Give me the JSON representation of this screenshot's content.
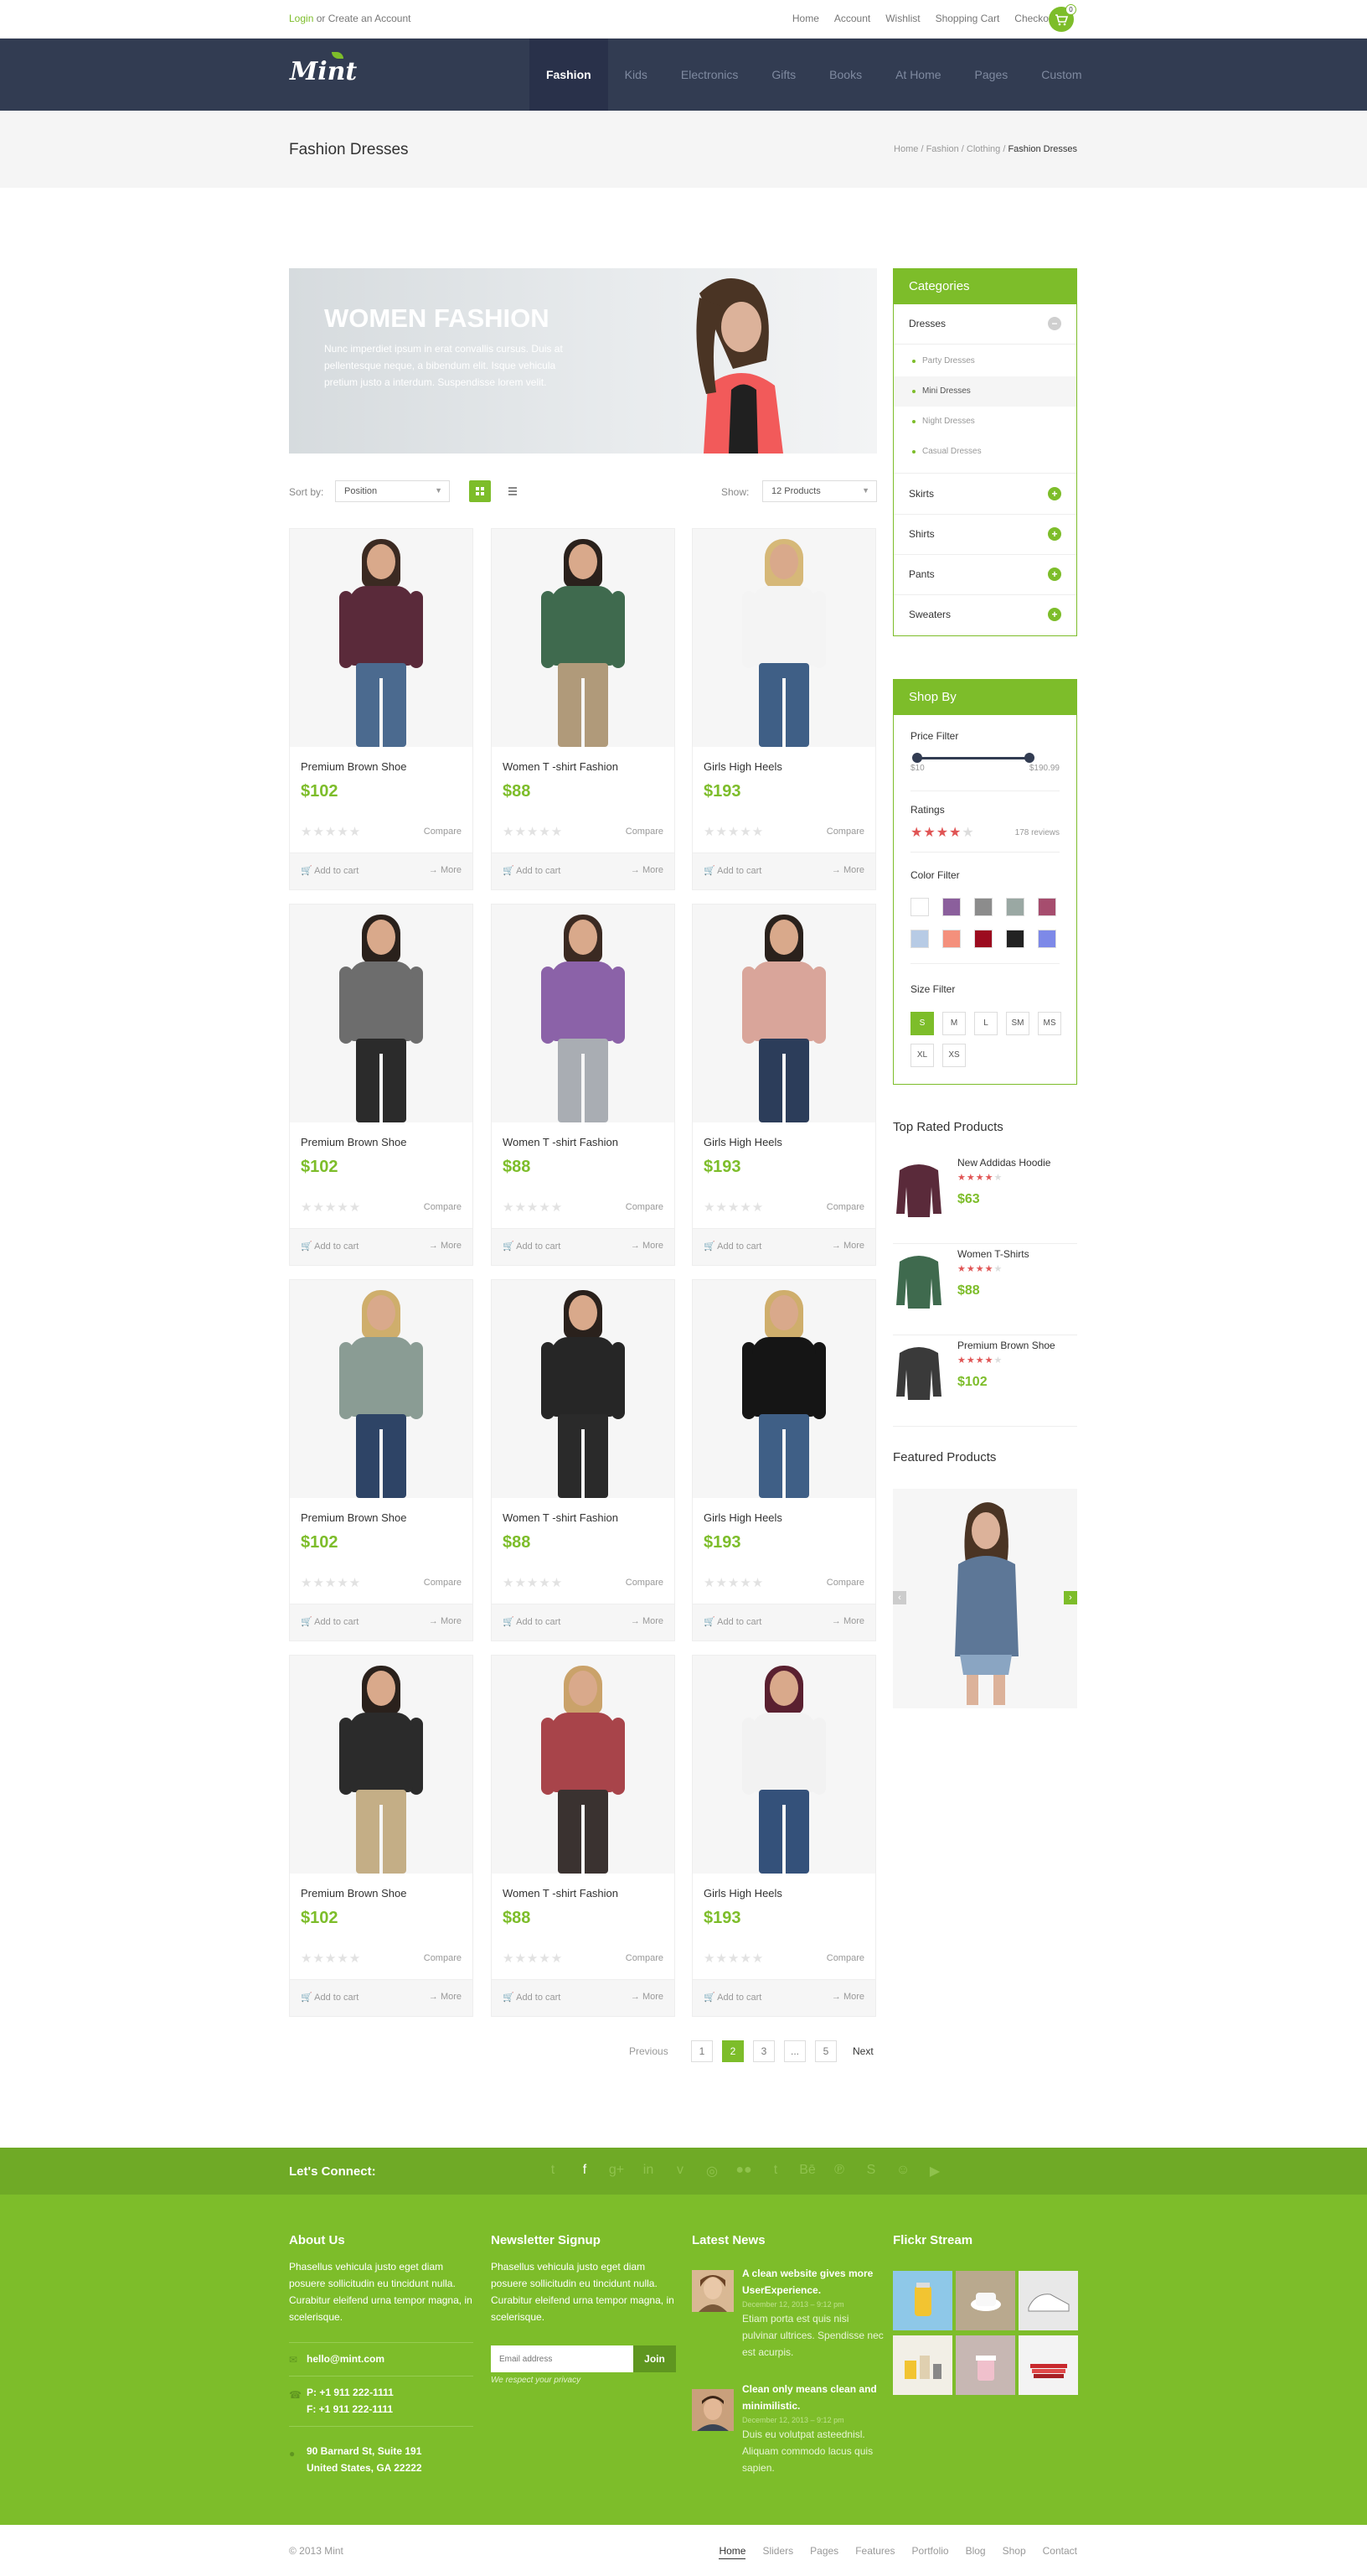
{
  "topbar": {
    "login": "Login",
    "or": "or",
    "create_account": "Create an Account",
    "links": [
      "Home",
      "Account",
      "Wishlist",
      "Shopping Cart",
      "Checkout"
    ],
    "cart_count": "0"
  },
  "brand": {
    "logo": "Mint",
    "accent": "#7dbd2a",
    "nav_bg": "#323c52"
  },
  "nav": [
    "Fashion",
    "Kids",
    "Electronics",
    "Gifts",
    "Books",
    "At Home",
    "Pages",
    "Custom"
  ],
  "page": {
    "title": "Fashion Dresses",
    "breadcrumb": [
      "Home",
      "Fashion",
      "Clothing",
      "Fashion Dresses"
    ],
    "breadcrumb_sep": "/"
  },
  "banner": {
    "title": "WOMEN FASHION",
    "text": "Nunc imperdiet ipsum in erat convallis cursus. Duis at pellentesque neque, a bibendum elit. Isque vehicula pretium justo a interdum. Suspendisse lorem velit."
  },
  "sort": {
    "sort_label": "Sort by:",
    "sort_value": "Position",
    "show_label": "Show:",
    "show_value": "12 Products",
    "grid_icon": "grid-icon",
    "list_icon": "list-icon"
  },
  "products": [
    {
      "name": "Premium Brown Shoe",
      "price": "$102",
      "compare": "Compare",
      "add": "Add to cart",
      "more": "More",
      "hair": "#3b2a22",
      "top": "#5a2a3a",
      "legs": "#4b6a8f"
    },
    {
      "name": "Women T -shirt Fashion",
      "price": "$88",
      "compare": "Compare",
      "add": "Add to cart",
      "more": "More",
      "hair": "#2a211c",
      "top": "#3f6a4e",
      "legs": "#b09a7a"
    },
    {
      "name": "Girls High Heels",
      "price": "$193",
      "compare": "Compare",
      "add": "Add to cart",
      "more": "More",
      "hair": "#d6b878",
      "top": "#f4f4f4",
      "legs": "#3f5f86"
    },
    {
      "name": "Premium Brown Shoe",
      "price": "$102",
      "compare": "Compare",
      "add": "Add to cart",
      "more": "More",
      "hair": "#2a211c",
      "top": "#6d6d6d",
      "legs": "#2b2b2b"
    },
    {
      "name": "Women T -shirt Fashion",
      "price": "$88",
      "compare": "Compare",
      "add": "Add to cart",
      "more": "More",
      "hair": "#3b2a22",
      "top": "#8b62a8",
      "legs": "#a9adb3"
    },
    {
      "name": "Girls High Heels",
      "price": "$193",
      "compare": "Compare",
      "add": "Add to cart",
      "more": "More",
      "hair": "#2a211c",
      "top": "#d9a59a",
      "legs": "#2c3d5a"
    },
    {
      "name": "Premium Brown Shoe",
      "price": "$102",
      "compare": "Compare",
      "add": "Add to cart",
      "more": "More",
      "hair": "#cfae6c",
      "top": "#8a9c94",
      "legs": "#2e4466"
    },
    {
      "name": "Women T -shirt Fashion",
      "price": "$88",
      "compare": "Compare",
      "add": "Add to cart",
      "more": "More",
      "hair": "#2a211c",
      "top": "#262626",
      "legs": "#2a2a2a"
    },
    {
      "name": "Girls High Heels",
      "price": "$193",
      "compare": "Compare",
      "add": "Add to cart",
      "more": "More",
      "hair": "#cfae6c",
      "top": "#151515",
      "legs": "#3f5f86"
    },
    {
      "name": "Premium Brown Shoe",
      "price": "$102",
      "compare": "Compare",
      "add": "Add to cart",
      "more": "More",
      "hair": "#2a211c",
      "top": "#2b2b2b",
      "legs": "#c4ae86"
    },
    {
      "name": "Women T -shirt Fashion",
      "price": "$88",
      "compare": "Compare",
      "add": "Add to cart",
      "more": "More",
      "hair": "#caa26a",
      "top": "#a8444a",
      "legs": "#3a3230"
    },
    {
      "name": "Girls High Heels",
      "price": "$193",
      "compare": "Compare",
      "add": "Add to cart",
      "more": "More",
      "hair": "#5a2030",
      "top": "#f2f2f2",
      "legs": "#34517a"
    }
  ],
  "pagination": {
    "prev": "Previous",
    "pages": [
      "1",
      "2",
      "3",
      "...",
      "5"
    ],
    "current": "2",
    "next": "Next"
  },
  "categories": {
    "title": "Categories",
    "open": "Dresses",
    "sub": [
      "Party Dresses",
      "Mini Dresses",
      "Night Dresses",
      "Casual Dresses"
    ],
    "active_sub": "Mini Dresses",
    "others": [
      "Skirts",
      "Shirts",
      "Pants",
      "Sweaters"
    ]
  },
  "shopby": {
    "title": "Shop By",
    "price_label": "Price Filter",
    "price_min": "$10",
    "price_max": "$190.99",
    "ratings_label": "Ratings",
    "reviews": "178 reviews",
    "rating": 4,
    "color_label": "Color Filter",
    "colors": [
      "#ffffff",
      "#8b5f9c",
      "#8c8c8c",
      "#9aa8a3",
      "#a64d6e",
      "#b7cbe5",
      "#f4907c",
      "#9c0b1f",
      "#222222",
      "#7d89e8"
    ],
    "size_label": "Size Filter",
    "sizes": [
      "S",
      "M",
      "L",
      "SM",
      "MS",
      "XL",
      "XS"
    ],
    "active_size": "S"
  },
  "top_rated": {
    "title": "Top Rated Products",
    "items": [
      {
        "name": "New Addidas Hoodie",
        "price": "$63",
        "color": "#5a2a3a"
      },
      {
        "name": "Women T-Shirts",
        "price": "$88",
        "color": "#3f6a4e"
      },
      {
        "name": "Premium Brown Shoe",
        "price": "$102",
        "color": "#3a3a3a"
      }
    ]
  },
  "featured": {
    "title": "Featured Products"
  },
  "footer": {
    "connect": "Let's Connect:",
    "social_icons": [
      "twitter-icon",
      "facebook-icon",
      "google-plus-icon",
      "linkedin-icon",
      "vimeo-icon",
      "dribbble-icon",
      "flickr-icon",
      "tumblr-icon",
      "behance-icon",
      "pinterest-icon",
      "skype-icon",
      "github-icon",
      "deviantart-icon"
    ],
    "social_glyphs": [
      "t",
      "f",
      "g+",
      "in",
      "v",
      "◎",
      "●●",
      "t",
      "Bē",
      "℗",
      "S",
      "☺",
      "▶"
    ],
    "about_title": "About Us",
    "about_text": "Phasellus vehicula justo eget diam posuere sollicitudin eu tincidunt nulla. Curabitur eleifend urna tempor magna, in scelerisque.",
    "email": "hello@mint.com",
    "phone": "P: +1 911 222-1111",
    "fax": "F: +1 911 222-1111",
    "address1": "90 Barnard St, Suite 191",
    "address2": "United States, GA 22222",
    "newsletter_title": "Newsletter Signup",
    "newsletter_text": "Phasellus vehicula justo eget diam posuere sollicitudin eu tincidunt nulla. Curabitur eleifend urna tempor magna, in scelerisque.",
    "email_placeholder": "Email address",
    "join": "Join",
    "privacy": "We respect your privacy",
    "news_title": "Latest News",
    "news": [
      {
        "title": "A clean website gives more UserExperience.",
        "date": "December 12, 2013 – 9:12 pm",
        "text": "Etiam porta est quis nisi pulvinar ultrices. Spendisse nec est acurpis."
      },
      {
        "title": "Clean only means clean and minimilistic.",
        "date": "December 12, 2013 – 9:12 pm",
        "text": "Duis eu volutpat asteednisl. Aliquam commodo lacus quis sapien."
      }
    ],
    "flickr_title": "Flickr Stream",
    "copyright": "© 2013 Mint",
    "bottom_nav": [
      "Home",
      "Sliders",
      "Pages",
      "Features",
      "Portfolio",
      "Blog",
      "Shop",
      "Contact"
    ]
  }
}
